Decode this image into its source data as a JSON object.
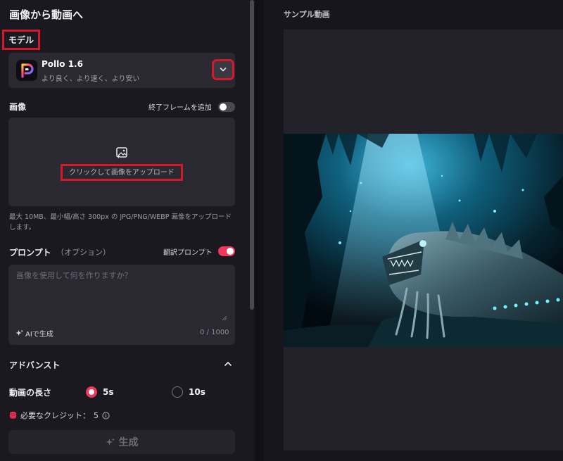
{
  "page": {
    "title": "画像から動画へ"
  },
  "model": {
    "section_label": "モデル",
    "name": "Pollo 1.6",
    "description": "より良く、より速く、より安い",
    "logo_icon": "pollo-logo-icon",
    "dropdown_icon": "chevron-down-icon"
  },
  "image": {
    "label": "画像",
    "end_frame_label": "終了フレームを追加",
    "end_frame_enabled": false,
    "upload_text": "クリックして画像をアップロード",
    "upload_icon": "image-add-icon",
    "hint": "最大 10MB、最小幅/高さ 300px の JPG/PNG/WEBP 画像をアップロードします。"
  },
  "prompt": {
    "label": "プロンプト",
    "optional": "（オプション）",
    "translate_label": "翻訳プロンプト",
    "translate_enabled": true,
    "placeholder": "画像を使用して何を作りますか？",
    "ai_generate": "AIで生成",
    "char_count": "0 / 1000"
  },
  "advanced": {
    "label": "アドバンスト",
    "expanded": true,
    "duration_label": "動画の長さ",
    "duration_options": [
      "5s",
      "10s"
    ],
    "duration_selected": "5s",
    "credits": "必要なクレジット：",
    "credits_value": "5"
  },
  "generate": {
    "label": "生成"
  },
  "sample": {
    "label": "サンプル動画"
  },
  "colors": {
    "accent": "#f0365c",
    "annotation_red": "#d41a2a",
    "panel": "#2a2932",
    "background": "#17161c"
  }
}
